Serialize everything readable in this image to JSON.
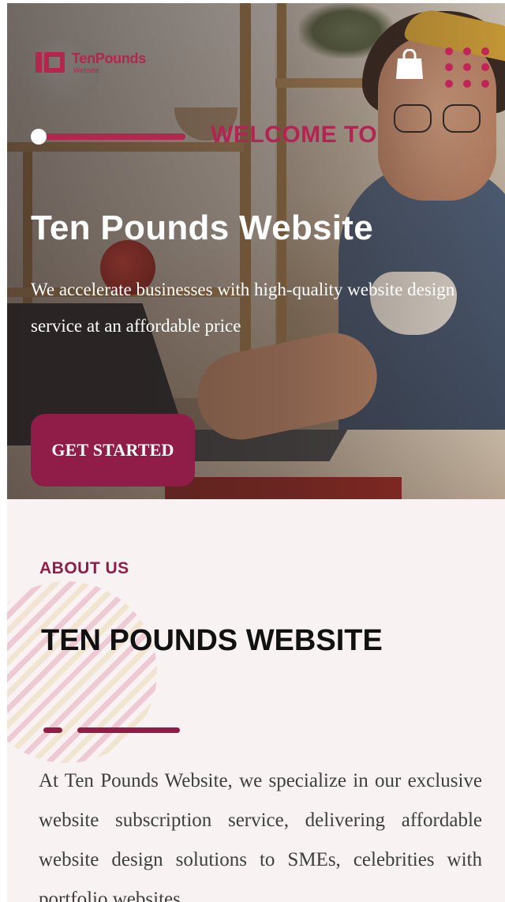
{
  "header": {
    "logo_name": "TenPounds",
    "logo_sub": "Website",
    "bag_icon": "shopping-bag-icon",
    "menu_icon": "grid-dots-menu-icon"
  },
  "hero": {
    "eyebrow": "WELCOME TO",
    "title": "Ten Pounds Website",
    "description": "We accelerate businesses with high-quality website design service at an affordable price",
    "cta_label": "GET STARTED"
  },
  "about": {
    "label": "ABOUT US",
    "title": "TEN POUNDS WEBSITE",
    "text": "At Ten Pounds Website, we specialize in our exclusive website subscription service, delivering affordable website design solutions to SMEs, celebrities with portfolio websites,"
  },
  "colors": {
    "brand": "#b3264d",
    "brand_dark": "#8f1d48",
    "about_bg": "#f8f2f3",
    "text_dark": "#111111",
    "text_body": "#3e3e3e"
  }
}
